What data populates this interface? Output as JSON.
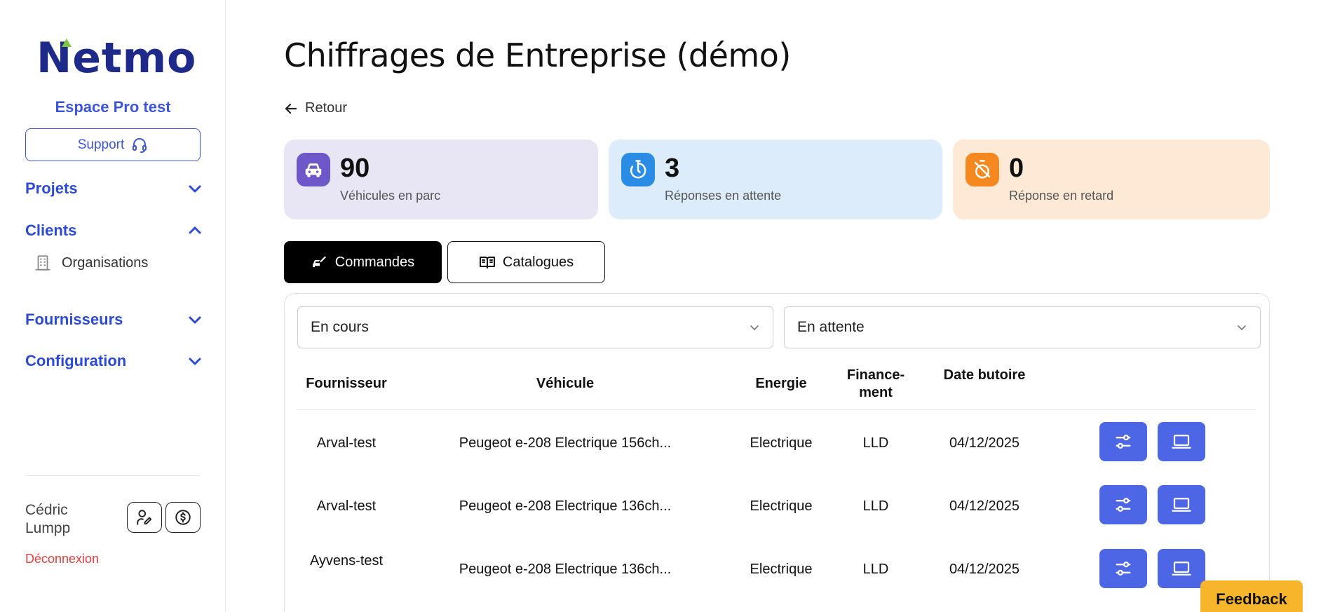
{
  "sidebar": {
    "logo_text": "Netmo",
    "space_title": "Espace Pro test",
    "support_label": "Support",
    "nav": [
      {
        "label": "Projets",
        "expanded": false
      },
      {
        "label": "Clients",
        "expanded": true
      },
      {
        "label": "Fournisseurs",
        "expanded": false
      },
      {
        "label": "Configuration",
        "expanded": false
      }
    ],
    "sub_item_label": "Organisations",
    "user_name": "Cédric Lumpp",
    "logout_label": "Déconnexion"
  },
  "main": {
    "title": "Chiffrages de Entreprise (démo)",
    "back_label": "Retour",
    "stats": [
      {
        "value": "90",
        "label": "Véhicules en parc",
        "bg": "#e8e6f5",
        "icon_bg": "#6e57c8",
        "icon": "car-icon"
      },
      {
        "value": "3",
        "label": "Réponses en attente",
        "bg": "#dcecfb",
        "icon_bg": "#2b8ce6",
        "icon": "timer-icon"
      },
      {
        "value": "0",
        "label": "Réponse en retard",
        "bg": "#fde9d6",
        "icon_bg": "#f5891f",
        "icon": "timer-off-icon"
      }
    ],
    "tabs": [
      {
        "label": "Commandes",
        "active": true
      },
      {
        "label": "Catalogues",
        "active": false
      }
    ],
    "filters": {
      "status": "En cours",
      "response": "En attente"
    },
    "table": {
      "headers": [
        "Fournisseur",
        "Véhicule",
        "Energie",
        "Finance-ment",
        "Date butoire"
      ],
      "rows": [
        {
          "fournisseur": "Arval-test",
          "vehicule": "Peugeot e-208 Electrique 156ch...",
          "energie": "Electrique",
          "financement": "LLD",
          "date": "04/12/2025"
        },
        {
          "fournisseur": "Arval-test",
          "vehicule": "Peugeot e-208 Electrique 136ch...",
          "energie": "Electrique",
          "financement": "LLD",
          "date": "04/12/2025"
        },
        {
          "fournisseur": "Ayvens-test",
          "vehicule": "Peugeot e-208 Electrique 136ch...",
          "energie": "Electrique",
          "financement": "LLD",
          "date": "04/12/2025"
        }
      ]
    }
  },
  "feedback_label": "Feedback",
  "colors": {
    "accent": "#3d55d9",
    "action_button": "#4d66e6",
    "logout": "#e53e3e",
    "feedback": "#f7b52c"
  }
}
